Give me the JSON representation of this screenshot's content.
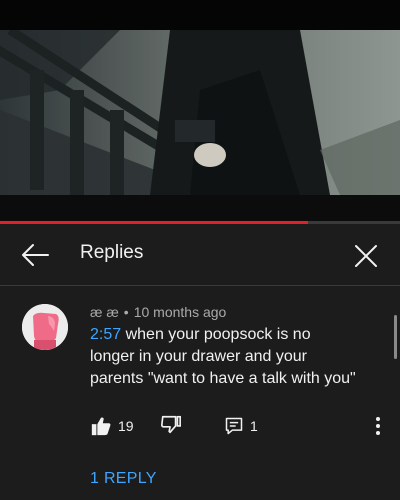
{
  "video": {
    "progress_fraction": 0.77
  },
  "header": {
    "title": "Replies"
  },
  "comment": {
    "author": "æ æ",
    "separator": "•",
    "age": "10 months ago",
    "timestamp": "2:57",
    "text_line1": " when your poopsock is no",
    "text_line2": "longer in your drawer and your",
    "text_line3": "parents \"want to have a talk with you\"",
    "likes": "19",
    "replies_count": "1",
    "view_replies_label": "1 REPLY"
  },
  "colors": {
    "accent_link": "#3ea6ff",
    "progress_red": "#e3202a",
    "panel_bg": "#1c1c1c"
  },
  "icons": {
    "back": "arrow-left-icon",
    "close": "close-icon",
    "like": "thumbs-up-icon",
    "dislike": "thumbs-down-icon",
    "reply": "comment-reply-icon",
    "more": "more-vertical-icon"
  }
}
